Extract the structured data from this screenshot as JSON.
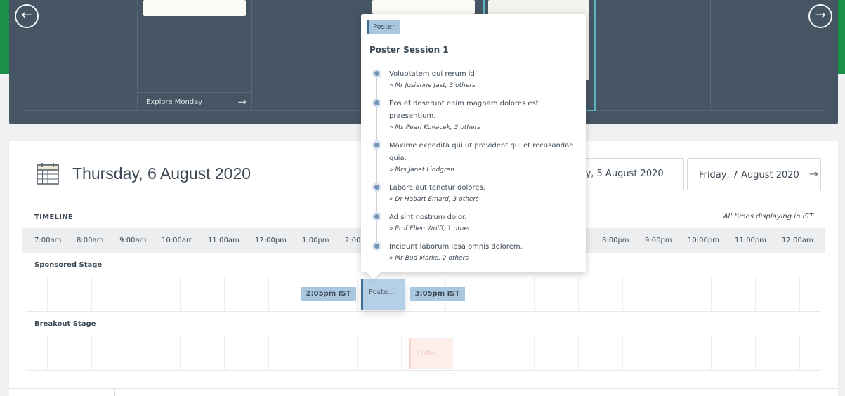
{
  "carousel": {
    "explore_label": "Explore Monday",
    "icons": {
      "prev": "arrow-left-icon",
      "next": "arrow-right-icon",
      "explore": "arrow-right-icon"
    }
  },
  "day": {
    "title": "Thursday, 6 August 2020",
    "prev_label": "Wednesday, 5 August 2020",
    "next_label": "Friday, 7 August 2020"
  },
  "timeline": {
    "label": "TIMELINE",
    "tz_note": "All times displaying in IST",
    "hours": [
      "7:00am",
      "8:00am",
      "9:00am",
      "10:00am",
      "11:00am",
      "12:00pm",
      "1:00pm",
      "2:00pm",
      "8:00pm",
      "9:00pm",
      "10:00pm",
      "11:00pm",
      "12:00am"
    ]
  },
  "stages": [
    {
      "name": "Sponsored Stage"
    },
    {
      "name": "Breakout Stage"
    }
  ],
  "active_event": {
    "short": "Poste...",
    "start": "2:05pm IST",
    "end": "3:05pm IST"
  },
  "coffee_event": {
    "short": "Coffe..."
  },
  "popover": {
    "tag": "Poster",
    "title": "Poster Session 1",
    "items": [
      {
        "title": "Voluptatem qui rerum id.",
        "speakers": "» Mr Josianne Jast, 3 others"
      },
      {
        "title": "Eos et deserunt enim magnam dolores est praesentium.",
        "speakers": "» Ms Pearl Kovacek, 3 others"
      },
      {
        "title": "Maxime expedita qui ut provident qui et recusandae quia.",
        "speakers": "» Mrs Janet Lindgren"
      },
      {
        "title": "Labore aut tenetur dolores.",
        "speakers": "» Dr Hobart Emard, 3 others"
      },
      {
        "title": "Ad sint nostrum dolor.",
        "speakers": "» Prof Ellen Wolff, 1 other"
      },
      {
        "title": "Incidunt laborum ipsa omnis dolorem.",
        "speakers": "» Mr Bud Marks, 2 others"
      }
    ]
  },
  "colors": {
    "brand_green": "#1b8f4a",
    "carousel_bg": "#465563",
    "event_blue": "#a9c8e0",
    "event_accent": "#3f6f94",
    "text": "#3d4a56"
  }
}
